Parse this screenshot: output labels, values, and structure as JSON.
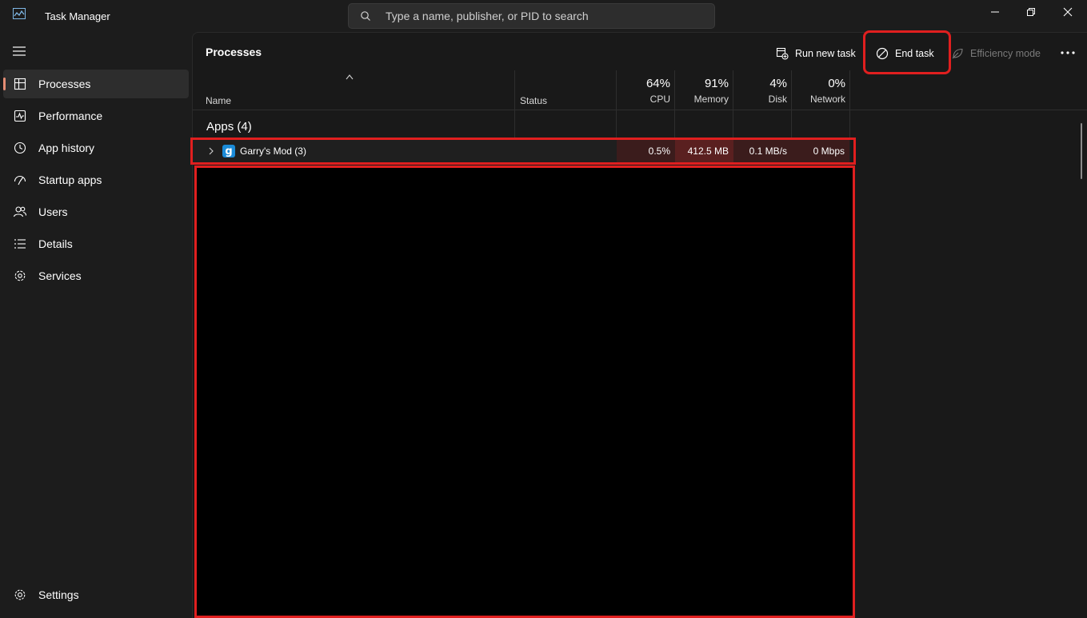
{
  "window": {
    "title": "Task Manager",
    "search_placeholder": "Type a name, publisher, or PID to search"
  },
  "sidebar": {
    "items": [
      {
        "label": "Processes",
        "icon": "processes-icon",
        "active": true
      },
      {
        "label": "Performance",
        "icon": "performance-icon"
      },
      {
        "label": "App history",
        "icon": "app-history-icon"
      },
      {
        "label": "Startup apps",
        "icon": "startup-apps-icon"
      },
      {
        "label": "Users",
        "icon": "users-icon"
      },
      {
        "label": "Details",
        "icon": "details-icon"
      },
      {
        "label": "Services",
        "icon": "services-icon"
      }
    ],
    "settings_label": "Settings"
  },
  "toolbar": {
    "title": "Processes",
    "run_new_task": "Run new task",
    "end_task": "End task",
    "efficiency_mode": "Efficiency mode"
  },
  "columns": {
    "name": "Name",
    "status": "Status",
    "cpu": {
      "percent": "64%",
      "label": "CPU"
    },
    "memory": {
      "percent": "91%",
      "label": "Memory"
    },
    "disk": {
      "percent": "4%",
      "label": "Disk"
    },
    "network": {
      "percent": "0%",
      "label": "Network"
    }
  },
  "group": {
    "label": "Apps (4)"
  },
  "process": {
    "name": "Garry's Mod (3)",
    "icon_letter": "g",
    "status": "",
    "cpu": "0.5%",
    "memory": "412.5 MB",
    "disk": "0.1 MB/s",
    "network": "0 Mbps"
  },
  "colors": {
    "accent": "#e58d74",
    "annotation": "#e01f1f",
    "heat_low": "#3b1c1c",
    "heat_high": "#5a2020"
  }
}
